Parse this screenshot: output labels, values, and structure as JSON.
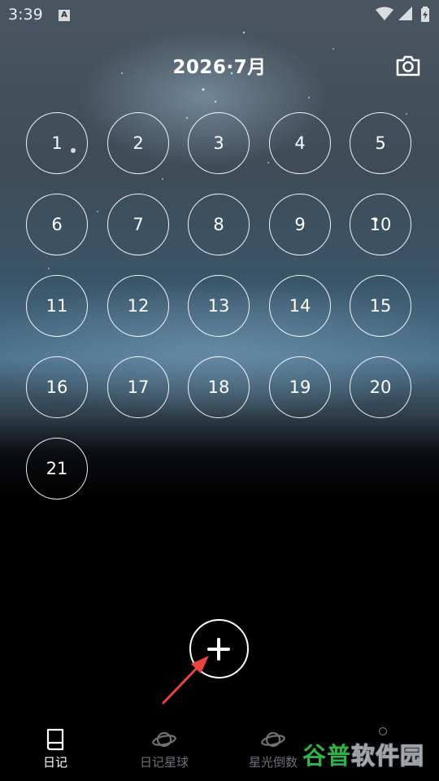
{
  "status_bar": {
    "time": "3:39",
    "a_icon_letter": "A"
  },
  "header": {
    "title": "2026·7月",
    "camera_icon": "camera-icon"
  },
  "calendar": {
    "days": [
      "1",
      "2",
      "3",
      "4",
      "5",
      "6",
      "7",
      "8",
      "9",
      "10",
      "11",
      "12",
      "13",
      "14",
      "15",
      "16",
      "17",
      "18",
      "19",
      "20",
      "21"
    ]
  },
  "add_button": {
    "icon": "plus-icon"
  },
  "bottom_nav": {
    "items": [
      {
        "label": "日记",
        "icon": "book-icon",
        "active": true
      },
      {
        "label": "日记星球",
        "icon": "planet-icon",
        "active": false
      },
      {
        "label": "星光倒数",
        "icon": "planet-icon",
        "active": false
      }
    ]
  },
  "watermark": {
    "green_text": "谷普",
    "white_text": "软件园"
  },
  "colors": {
    "accent_green": "#2fb24a",
    "annotation_arrow": "#e8453c"
  }
}
